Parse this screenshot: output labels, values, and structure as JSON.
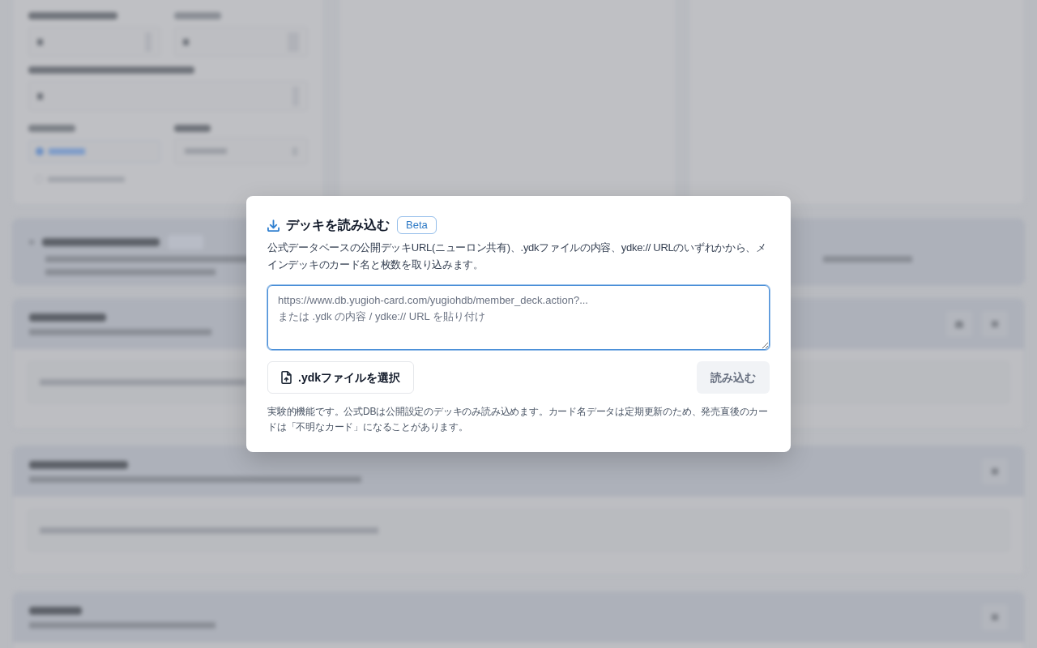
{
  "dialog": {
    "title": "デッキを読み込む",
    "badge": "Beta",
    "description": "公式データベースの公開デッキURL(ニューロン共有)、.ydkファイルの内容、ydke:// URLのいずれかから、メインデッキのカード名と枚数を取り込みます。",
    "input": {
      "placeholder": "https://www.db.yugioh-card.com/yugiohdb/member_deck.action?...\nまたは .ydk の内容 / ydke:// URL を貼り付け",
      "focused": true
    },
    "file_button": {
      "label": ".ydkファイルを選択"
    },
    "import_button": {
      "label": "読み込む",
      "disabled": true
    },
    "note": "実験的機能です。公式DBは公開設定のデッキのみ読み込めます。カード名データは定期更新のため、発売直後のカードは「不明なカード」になることがあります。"
  }
}
